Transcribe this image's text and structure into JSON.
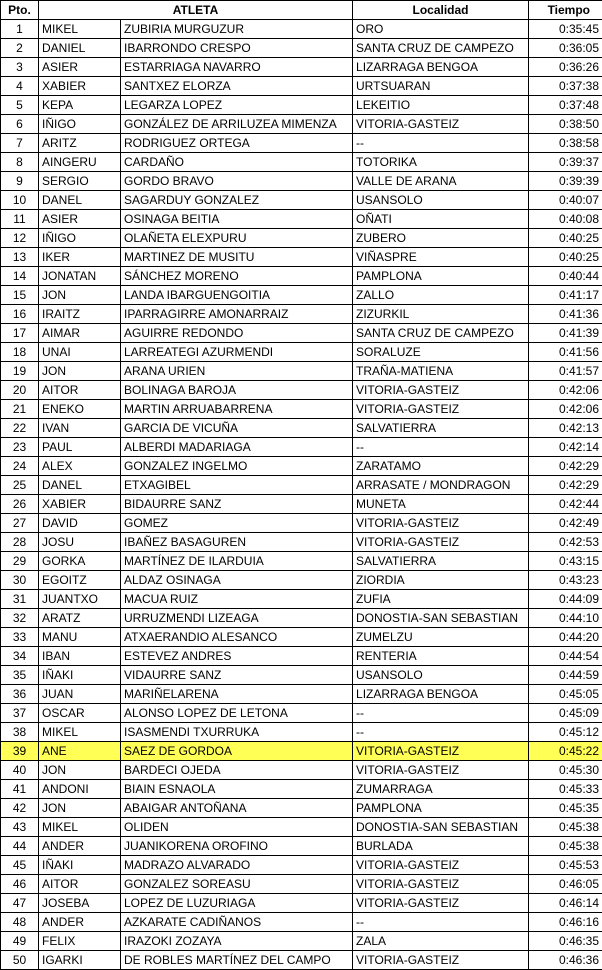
{
  "table": {
    "headers": {
      "pos": "Pto.",
      "athlete": "ATLETA",
      "town": "Localidad",
      "time": "Tiempo"
    },
    "highlight_color": "#ffff55",
    "rows": [
      {
        "pos": "1",
        "first": "MIKEL",
        "last": "ZUBIRIA MURGUZUR",
        "town": "ORO",
        "time": "0:35:45"
      },
      {
        "pos": "2",
        "first": "DANIEL",
        "last": "IBARRONDO CRESPO",
        "town": "SANTA CRUZ DE CAMPEZO",
        "time": "0:36:05"
      },
      {
        "pos": "3",
        "first": "ASIER",
        "last": "ESTARRIAGA NAVARRO",
        "town": "LIZARRAGA BENGOA",
        "time": "0:36:26"
      },
      {
        "pos": "4",
        "first": "XABIER",
        "last": "SANTXEZ ELORZA",
        "town": "URTSUARAN",
        "time": "0:37:38"
      },
      {
        "pos": "5",
        "first": "KEPA",
        "last": "LEGARZA LOPEZ",
        "town": "LEKEITIO",
        "time": "0:37:48"
      },
      {
        "pos": "6",
        "first": "IÑIGO",
        "last": "GONZÁLEZ DE ARRILUZEA MIMENZA",
        "town": "VITORIA-GASTEIZ",
        "time": "0:38:50"
      },
      {
        "pos": "7",
        "first": "ARITZ",
        "last": "RODRIGUEZ ORTEGA",
        "town": "--",
        "time": "0:38:58"
      },
      {
        "pos": "8",
        "first": "AINGERU",
        "last": "CARDAÑO",
        "town": "TOTORIKA",
        "time": "0:39:37"
      },
      {
        "pos": "9",
        "first": "SERGIO",
        "last": "GORDO BRAVO",
        "town": "VALLE DE ARANA",
        "time": "0:39:39"
      },
      {
        "pos": "10",
        "first": "DANEL",
        "last": "SAGARDUY GONZALEZ",
        "town": "USANSOLO",
        "time": "0:40:07"
      },
      {
        "pos": "11",
        "first": "ASIER",
        "last": "OSINAGA BEITIA",
        "town": "OÑATI",
        "time": "0:40:08"
      },
      {
        "pos": "12",
        "first": "IÑIGO",
        "last": "OLAÑETA ELEXPURU",
        "town": "ZUBERO",
        "time": "0:40:25"
      },
      {
        "pos": "13",
        "first": "IKER",
        "last": "MARTINEZ DE MUSITU",
        "town": "VIÑASPRE",
        "time": "0:40:25"
      },
      {
        "pos": "14",
        "first": "JONATAN",
        "last": "SÁNCHEZ MORENO",
        "town": "PAMPLONA",
        "time": "0:40:44"
      },
      {
        "pos": "15",
        "first": "JON",
        "last": "LANDA IBARGUENGOITIA",
        "town": "ZALLO",
        "time": "0:41:17"
      },
      {
        "pos": "16",
        "first": "IRAITZ",
        "last": "IPARRAGIRRE AMONARRAIZ",
        "town": "ZIZURKIL",
        "time": "0:41:36"
      },
      {
        "pos": "17",
        "first": "AIMAR",
        "last": "AGUIRRE REDONDO",
        "town": "SANTA CRUZ DE CAMPEZO",
        "time": "0:41:39"
      },
      {
        "pos": "18",
        "first": "UNAI",
        "last": "LARREATEGI AZURMENDI",
        "town": "SORALUZE",
        "time": "0:41:56"
      },
      {
        "pos": "19",
        "first": "JON",
        "last": "ARANA URIEN",
        "town": "TRAÑA-MATIENA",
        "time": "0:41:57"
      },
      {
        "pos": "20",
        "first": "AITOR",
        "last": "BOLINAGA BAROJA",
        "town": "VITORIA-GASTEIZ",
        "time": "0:42:06"
      },
      {
        "pos": "21",
        "first": "ENEKO",
        "last": "MARTIN ARRUABARRENA",
        "town": "VITORIA-GASTEIZ",
        "time": "0:42:06"
      },
      {
        "pos": "22",
        "first": "IVAN",
        "last": "GARCIA DE VICUÑA",
        "town": "SALVATIERRA",
        "time": "0:42:13"
      },
      {
        "pos": "23",
        "first": "PAUL",
        "last": "ALBERDI MADARIAGA",
        "town": "--",
        "time": "0:42:14"
      },
      {
        "pos": "24",
        "first": "ALEX",
        "last": "GONZALEZ INGELMO",
        "town": "ZARATAMO",
        "time": "0:42:29"
      },
      {
        "pos": "25",
        "first": "DANEL",
        "last": "ETXAGIBEL",
        "town": "ARRASATE / MONDRAGON",
        "time": "0:42:29"
      },
      {
        "pos": "26",
        "first": "XABIER",
        "last": "BIDAURRE SANZ",
        "town": "MUNETA",
        "time": "0:42:44"
      },
      {
        "pos": "27",
        "first": "DAVID",
        "last": "GOMEZ",
        "town": "VITORIA-GASTEIZ",
        "time": "0:42:49"
      },
      {
        "pos": "28",
        "first": "JOSU",
        "last": "IBAÑEZ BASAGUREN",
        "town": "VITORIA-GASTEIZ",
        "time": "0:42:53"
      },
      {
        "pos": "29",
        "first": "GORKA",
        "last": "MARTÍNEZ DE ILARDUIA",
        "town": "SALVATIERRA",
        "time": "0:43:15"
      },
      {
        "pos": "30",
        "first": "EGOITZ",
        "last": "ALDAZ OSINAGA",
        "town": "ZIORDIA",
        "time": "0:43:23"
      },
      {
        "pos": "31",
        "first": "JUANTXO",
        "last": "MACUA RUIZ",
        "town": "ZUFIA",
        "time": "0:44:09"
      },
      {
        "pos": "32",
        "first": "ARATZ",
        "last": "URRUZMENDI LIZEAGA",
        "town": "DONOSTIA-SAN SEBASTIAN",
        "time": "0:44:10"
      },
      {
        "pos": "33",
        "first": "MANU",
        "last": "ATXAERANDIO ALESANCO",
        "town": "ZUMELZU",
        "time": "0:44:20"
      },
      {
        "pos": "34",
        "first": "IBAN",
        "last": "ESTEVEZ ANDRES",
        "town": "RENTERIA",
        "time": "0:44:54"
      },
      {
        "pos": "35",
        "first": "IÑAKI",
        "last": "VIDAURRE SANZ",
        "town": "USANSOLO",
        "time": "0:44:59"
      },
      {
        "pos": "36",
        "first": "JUAN",
        "last": "MARIÑELARENA",
        "town": "LIZARRAGA BENGOA",
        "time": "0:45:05"
      },
      {
        "pos": "37",
        "first": "OSCAR",
        "last": "ALONSO LOPEZ DE LETONA",
        "town": "--",
        "time": "0:45:09"
      },
      {
        "pos": "38",
        "first": "MIKEL",
        "last": "ISASMENDI TXURRUKA",
        "town": "--",
        "time": "0:45:12"
      },
      {
        "pos": "39",
        "first": "ANE",
        "last": "SAEZ DE GORDOA",
        "town": "VITORIA-GASTEIZ",
        "time": "0:45:22",
        "highlight": true
      },
      {
        "pos": "40",
        "first": "JON",
        "last": "BARDECI OJEDA",
        "town": "VITORIA-GASTEIZ",
        "time": "0:45:30"
      },
      {
        "pos": "41",
        "first": "ANDONI",
        "last": "BIAIN ESNAOLA",
        "town": "ZUMARRAGA",
        "time": "0:45:33"
      },
      {
        "pos": "42",
        "first": "JON",
        "last": "ABAIGAR ANTOÑANA",
        "town": "PAMPLONA",
        "time": "0:45:35"
      },
      {
        "pos": "43",
        "first": "MIKEL",
        "last": "OLIDEN",
        "town": "DONOSTIA-SAN SEBASTIAN",
        "time": "0:45:38"
      },
      {
        "pos": "44",
        "first": "ANDER",
        "last": "JUANIKORENA OROFINO",
        "town": "BURLADA",
        "time": "0:45:38"
      },
      {
        "pos": "45",
        "first": "IÑAKI",
        "last": "MADRAZO ALVARADO",
        "town": "VITORIA-GASTEIZ",
        "time": "0:45:53"
      },
      {
        "pos": "46",
        "first": "AITOR",
        "last": "GONZALEZ SOREASU",
        "town": "VITORIA-GASTEIZ",
        "time": "0:46:05"
      },
      {
        "pos": "47",
        "first": "JOSEBA",
        "last": "LOPEZ DE LUZURIAGA",
        "town": "VITORIA-GASTEIZ",
        "time": "0:46:14"
      },
      {
        "pos": "48",
        "first": "ANDER",
        "last": "AZKARATE CADIÑANOS",
        "town": "--",
        "time": "0:46:16"
      },
      {
        "pos": "49",
        "first": "FELIX",
        "last": "IRAZOKI ZOZAYA",
        "town": "ZALA",
        "time": "0:46:35"
      },
      {
        "pos": "50",
        "first": "IGARKI",
        "last": "DE ROBLES MARTÍNEZ DEL CAMPO",
        "town": "VITORIA-GASTEIZ",
        "time": "0:46:36"
      }
    ]
  }
}
